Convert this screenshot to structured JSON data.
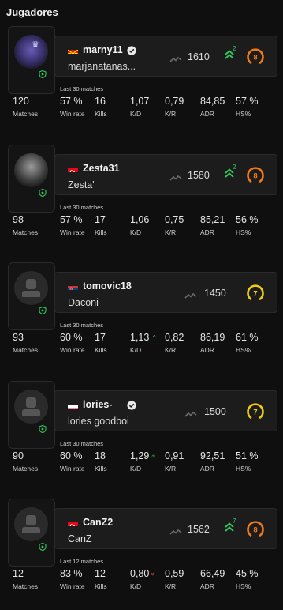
{
  "section_title": "Jugadores",
  "labels": {
    "matches": "Matches",
    "win_rate": "Win rate",
    "kills": "Kills",
    "kd": "K/D",
    "kr": "K/R",
    "adr": "ADR",
    "hs": "HS%"
  },
  "colors": {
    "level_orange": "#f07a1a",
    "level_yellow": "#f2cc0c",
    "rank_up_green": "#30c95a"
  },
  "players": [
    {
      "nickname": "marny11",
      "name": "marjanatanas...",
      "flag": "macedonia",
      "verified": true,
      "avatar": "custom-crown",
      "elo": "1610",
      "rank_change": "2",
      "level": "8",
      "period": "Last 30 matches",
      "matches": "120",
      "win_rate": "57 %",
      "kills": "16",
      "kd": "1,07",
      "kd_trend": "",
      "kr": "0,79",
      "adr": "84,85",
      "hs": "57 %"
    },
    {
      "nickname": "Zesta31",
      "name": "Zesta'",
      "flag": "turkey",
      "verified": false,
      "avatar": "custom-photo",
      "elo": "1580",
      "rank_change": "2",
      "level": "8",
      "period": "Last 30 matches",
      "matches": "98",
      "win_rate": "57 %",
      "kills": "17",
      "kd": "1,06",
      "kd_trend": "",
      "kr": "0,75",
      "adr": "85,21",
      "hs": "56 %"
    },
    {
      "nickname": "tomovic18",
      "name": "Daconi",
      "flag": "serbia",
      "verified": false,
      "avatar": "default",
      "elo": "1450",
      "rank_change": "",
      "level": "7",
      "period": "Last 30 matches",
      "matches": "93",
      "win_rate": "60 %",
      "kills": "17",
      "kd": "1,13",
      "kd_trend": "up",
      "kr": "0,82",
      "adr": "86,19",
      "hs": "61 %"
    },
    {
      "nickname": "lories-",
      "name": "lories goodboi",
      "flag": "poland",
      "verified": true,
      "avatar": "default",
      "elo": "1500",
      "rank_change": "",
      "level": "7",
      "period": "Last 30 matches",
      "matches": "90",
      "win_rate": "60 %",
      "kills": "18",
      "kd": "1,29",
      "kd_trend": "double-up",
      "kr": "0,91",
      "adr": "92,51",
      "hs": "51 %"
    },
    {
      "nickname": "CanZ2",
      "name": "CanZ",
      "flag": "turkey",
      "verified": false,
      "avatar": "default",
      "elo": "1562",
      "rank_change": "7",
      "level": "8",
      "period": "Last 12 matches",
      "matches": "12",
      "win_rate": "83 %",
      "kills": "12",
      "kd": "0,80",
      "kd_trend": "double-down",
      "kr": "0,59",
      "adr": "66,49",
      "hs": "45 %"
    }
  ]
}
